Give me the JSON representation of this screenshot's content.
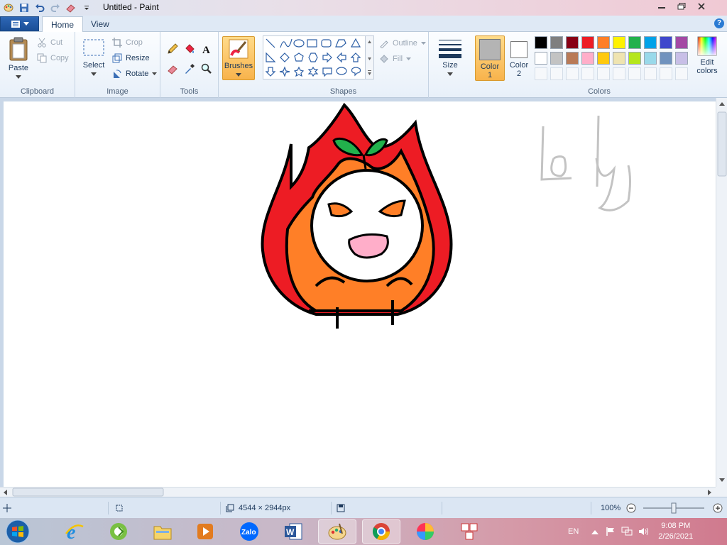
{
  "window": {
    "title": "Untitled - Paint"
  },
  "tabs": [
    {
      "label": "Home"
    },
    {
      "label": "View"
    }
  ],
  "ribbon": {
    "clipboard": {
      "label": "Clipboard",
      "paste": "Paste",
      "cut": "Cut",
      "copy": "Copy"
    },
    "image": {
      "label": "Image",
      "select": "Select",
      "crop": "Crop",
      "resize": "Resize",
      "rotate": "Rotate"
    },
    "tools": {
      "label": "Tools"
    },
    "brushes": {
      "label": "Brushes"
    },
    "shapes": {
      "label": "Shapes",
      "outline": "Outline",
      "fill": "Fill"
    },
    "size": {
      "label": "Size"
    },
    "colors": {
      "label": "Colors",
      "color1": "Color\n1",
      "color1_a": "Color",
      "color1_b": "1",
      "color2_a": "Color",
      "color2_b": "2",
      "edit_a": "Edit",
      "edit_b": "colors",
      "color1_value": "#b4b4b4",
      "color2_value": "#ffffff",
      "palette_row1": [
        "#000000",
        "#7f7f7f",
        "#880015",
        "#ed1c24",
        "#ff7f27",
        "#fff200",
        "#22b14c",
        "#00a2e8",
        "#3f48cc",
        "#a349a4"
      ],
      "palette_row2": [
        "#ffffff",
        "#c3c3c3",
        "#b97a57",
        "#ffaec9",
        "#ffc90e",
        "#efe4b0",
        "#b5e61d",
        "#99d9ea",
        "#7092be",
        "#c8bfe7"
      ]
    }
  },
  "canvas": {
    "handwriting": "Loly"
  },
  "status": {
    "dimensions": "4544 × 2944px",
    "zoom": "100%",
    "zoom_level": 1.0
  },
  "taskbar": {
    "language": "EN",
    "time": "9:08 PM",
    "date": "2/26/2021",
    "zalo": "Zalo"
  }
}
